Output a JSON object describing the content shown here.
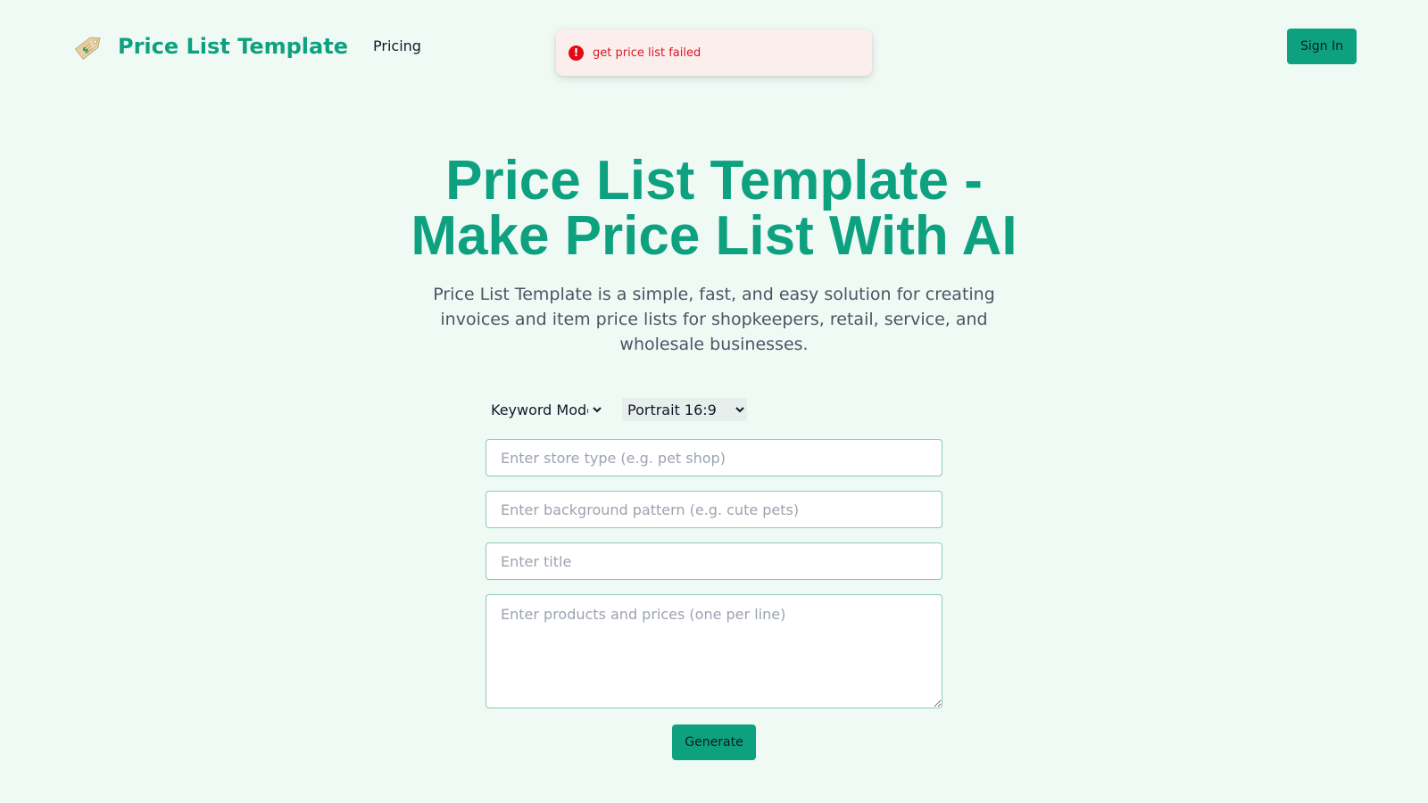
{
  "header": {
    "brand": {
      "name": "Price List Template",
      "logo_icon": "price-tag-icon"
    },
    "nav": {
      "pricing_label": "Pricing"
    },
    "signin_label": "Sign In"
  },
  "toast": {
    "type": "error",
    "icon": "error-icon",
    "icon_glyph": "!",
    "message": "get price list failed"
  },
  "hero": {
    "title_line1": "Price List Template -",
    "title_line2": "Make Price List With AI",
    "description": "Price List Template is a simple, fast, and easy solution for creating invoices and item price lists for shopkeepers, retail, service, and wholesale businesses."
  },
  "form": {
    "mode": {
      "selected": "Keyword Mode",
      "options": [
        "Keyword Mode"
      ]
    },
    "ratio": {
      "selected": "Portrait 16:9",
      "options": [
        "Portrait 16:9"
      ]
    },
    "store_type": {
      "placeholder": "Enter store type (e.g. pet shop)",
      "value": ""
    },
    "background_pattern": {
      "placeholder": "Enter background pattern (e.g. cute pets)",
      "value": ""
    },
    "title": {
      "placeholder": "Enter title",
      "value": ""
    },
    "products": {
      "placeholder": "Enter products and prices (one per line)",
      "value": ""
    },
    "generate_label": "Generate"
  },
  "colors": {
    "background": "#effaf5",
    "brand": "#0ea180",
    "toast_background": "#fdeeee",
    "toast_text": "#d71924",
    "error_icon": "#e00b14",
    "input_border": "#8cc9b5",
    "muted_text": "#4b5563"
  }
}
